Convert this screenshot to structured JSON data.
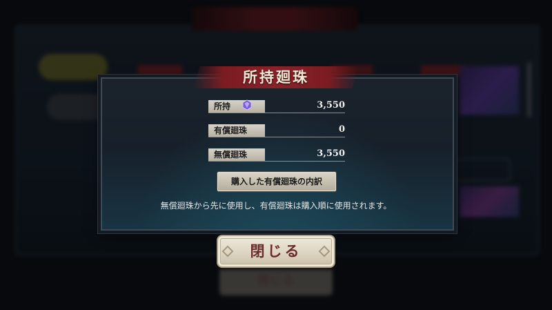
{
  "background": {
    "title": "",
    "tab_active": "",
    "tab_other": "",
    "close_label": "閉じる"
  },
  "dialog": {
    "title": "所持廻珠",
    "rows": [
      {
        "label": "所持",
        "value": "3,550",
        "icon": "gem-icon"
      },
      {
        "label": "有償廻珠",
        "value": "0"
      },
      {
        "label": "無償廻珠",
        "value": "3,550"
      }
    ],
    "detail_button": "購入した有償廻珠の内訳",
    "note": "無償廻珠から先に使用し、有償廻珠は購入順に使用されます。"
  },
  "close_button": "閉じる",
  "colors": {
    "title_band": "#8a2229",
    "dialog_bg": "#17202a",
    "label_bg": "#d7d3c8",
    "close_text": "#6a2b2b"
  }
}
